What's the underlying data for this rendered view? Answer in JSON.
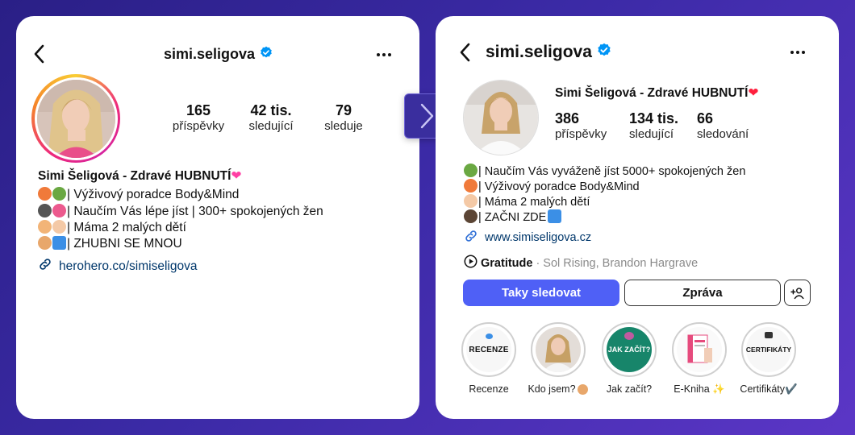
{
  "left": {
    "username": "simi.seligova",
    "stats": [
      {
        "value": "165",
        "label": "příspěvky"
      },
      {
        "value": "42 tis.",
        "label": "sledující"
      },
      {
        "value": "79",
        "label": "sleduje"
      }
    ],
    "name": "Simi Šeligová - Zdravé HUBNUTÍ",
    "bio": [
      "| Výživový poradce Body&Mind",
      "| Naučím Vás lépe jíst | 300+ spokojených žen",
      "| Máma 2 malých dětí",
      "| ZHUBNI SE MNOU"
    ],
    "link": "herohero.co/simiseligova"
  },
  "right": {
    "username": "simi.seligova",
    "name": "Simi Šeligová - Zdravé HUBNUTÍ",
    "stats": [
      {
        "value": "386",
        "label": "příspěvky"
      },
      {
        "value": "134 tis.",
        "label": "sledující"
      },
      {
        "value": "66",
        "label": "sledování"
      }
    ],
    "bio": [
      "| Naučím Vás vyváženě jíst 5000+ spokojených žen",
      "| Výživový poradce Body&Mind",
      "| Máma 2 malých dětí",
      "| ZAČNI ZDE"
    ],
    "link": "www.simiseligova.cz",
    "music": {
      "title": "Gratitude",
      "artist": "· Sol Rising, Brandon Hargrave"
    },
    "buttons": {
      "follow": "Taky sledovat",
      "message": "Zpráva"
    },
    "highlights": [
      {
        "title": "Recenze",
        "cover_text": "RECENZE"
      },
      {
        "title": "Kdo jsem?",
        "cover_text": ""
      },
      {
        "title": "Jak začít?",
        "cover_text": "JAK ZAČÍT?"
      },
      {
        "title": "E-Kniha ✨",
        "cover_text": ""
      },
      {
        "title": "Certifikáty✔️",
        "cover_text": "CERTIFIKÁTY"
      }
    ]
  },
  "colors": {
    "accent": "#4f60f6",
    "link": "#00376b",
    "verified": "#0095f6"
  }
}
